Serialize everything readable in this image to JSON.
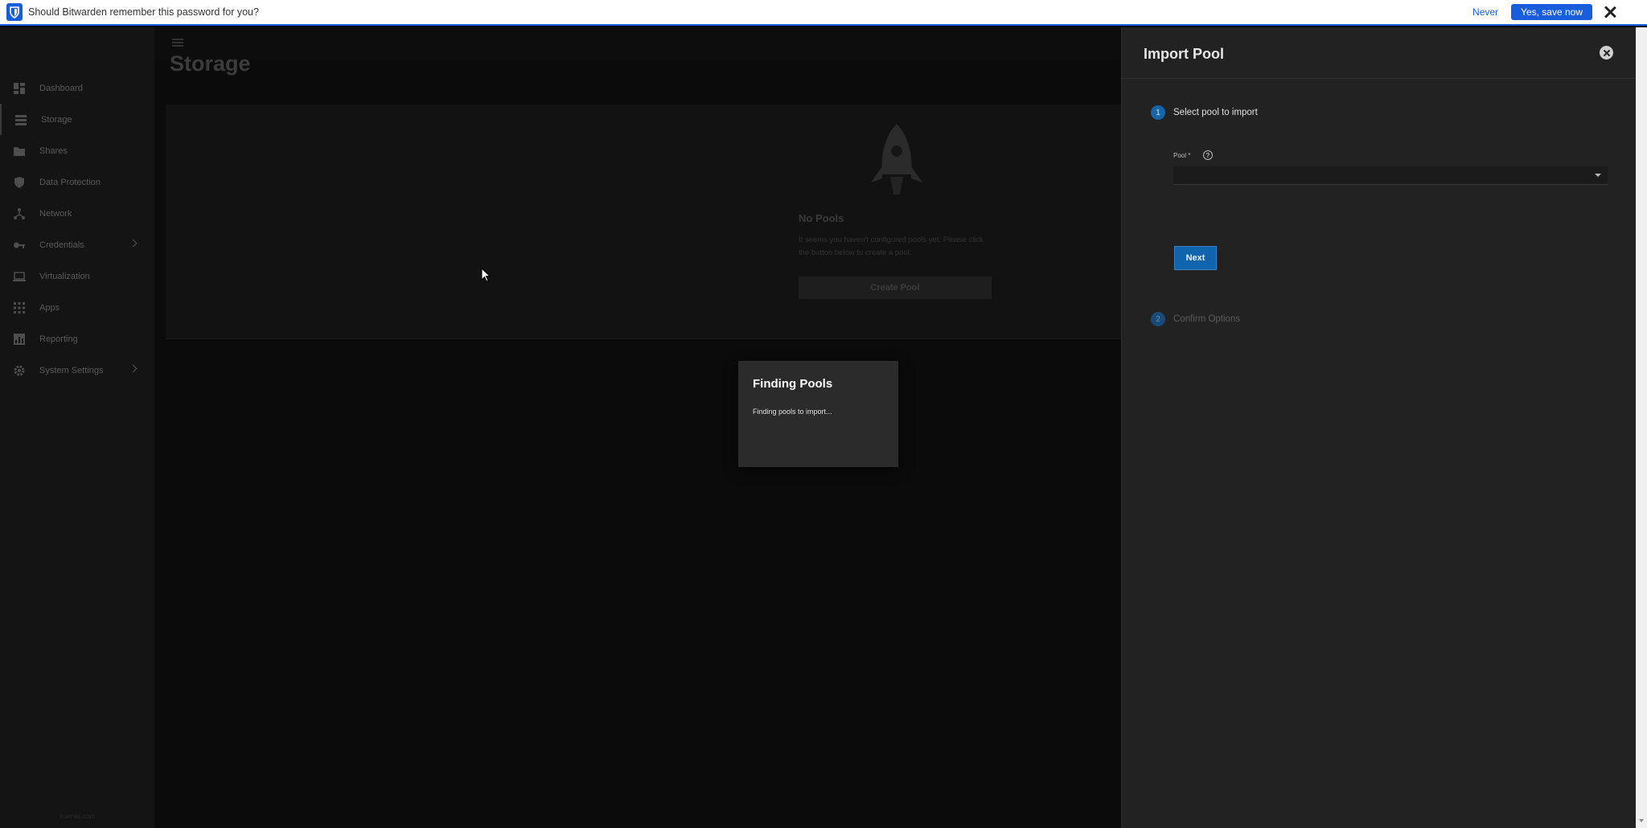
{
  "bitwarden": {
    "message": "Should Bitwarden remember this password for you?",
    "never_label": "Never",
    "save_label": "Yes, save now"
  },
  "sidebar": {
    "items": [
      {
        "label": "Dashboard",
        "icon": "dashboard-icon"
      },
      {
        "label": "Storage",
        "icon": "storage-icon"
      },
      {
        "label": "Shares",
        "icon": "folder-share-icon"
      },
      {
        "label": "Data Protection",
        "icon": "shield-icon"
      },
      {
        "label": "Network",
        "icon": "network-icon"
      },
      {
        "label": "Credentials",
        "icon": "key-icon"
      },
      {
        "label": "Virtualization",
        "icon": "laptop-icon"
      },
      {
        "label": "Apps",
        "icon": "apps-grid-icon"
      },
      {
        "label": "Reporting",
        "icon": "chart-icon"
      },
      {
        "label": "System Settings",
        "icon": "gear-icon"
      }
    ],
    "footer": "truenas.com"
  },
  "page": {
    "title": "Storage"
  },
  "empty_state": {
    "title": "No Pools",
    "text": "It seems you haven't configured pools yet. Please click the button below to create a pool.",
    "button_label": "Create Pool"
  },
  "dialog": {
    "title": "Finding Pools",
    "text": "Finding pools to import..."
  },
  "import_panel": {
    "title": "Import Pool",
    "step1_number": "1",
    "step1_label": "Select pool to import",
    "pool_label": "Pool *",
    "help_glyph": "?",
    "pool_value": "",
    "next_label": "Next",
    "step2_number": "2",
    "step2_label": "Confirm Options"
  },
  "colors": {
    "bitwarden_blue": "#175ddc",
    "primary_blue": "#0f64ad",
    "panel_bg": "#222222"
  }
}
